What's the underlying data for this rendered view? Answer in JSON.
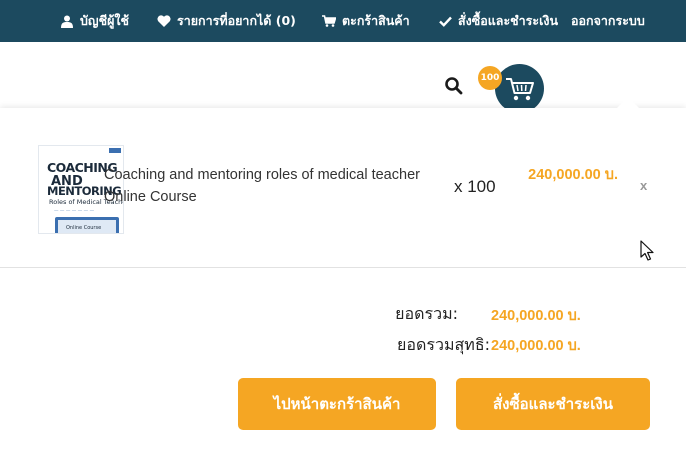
{
  "topnav": {
    "account": {
      "label": "บัญชีผู้ใช้",
      "icon": "user-icon"
    },
    "wishlist": {
      "label": "รายการที่อยากได้ (0)",
      "icon": "heart-icon"
    },
    "cart": {
      "label": "ตะกร้าสินค้า",
      "icon": "cart-icon"
    },
    "checkout": {
      "label": "สั่งซื้อและชำระเงิน",
      "icon": "check-icon"
    },
    "logout": {
      "label": "ออกจากระบบ"
    }
  },
  "header": {
    "search_icon": "search-icon",
    "cart_icon": "cart-icon",
    "cart_count": "100"
  },
  "cart_item": {
    "thumbnail": {
      "line1": "COACHING",
      "line2": "AND",
      "line3": "MENTORING",
      "line4": "Roles of Medical Teachers",
      "screen": "Online Course"
    },
    "name": "Coaching and mentoring roles of medical teacher Online Course",
    "quantity": "x 100",
    "price": "240,000.00 บ.",
    "remove_label": "x"
  },
  "summary": {
    "subtotal_label": "ยอดรวม:",
    "subtotal_value": "240,000.00 บ.",
    "net_total_label": "ยอดรวมสุทธิ:",
    "net_total_value": "240,000.00 บ."
  },
  "actions": {
    "view_cart_label": "ไปหน้าตะกร้าสินค้า",
    "checkout_label": "สั่งซื้อและชำระเงิน"
  },
  "colors": {
    "topbar": "#1c4a5f",
    "accent": "#f5a623",
    "text": "#222222"
  }
}
